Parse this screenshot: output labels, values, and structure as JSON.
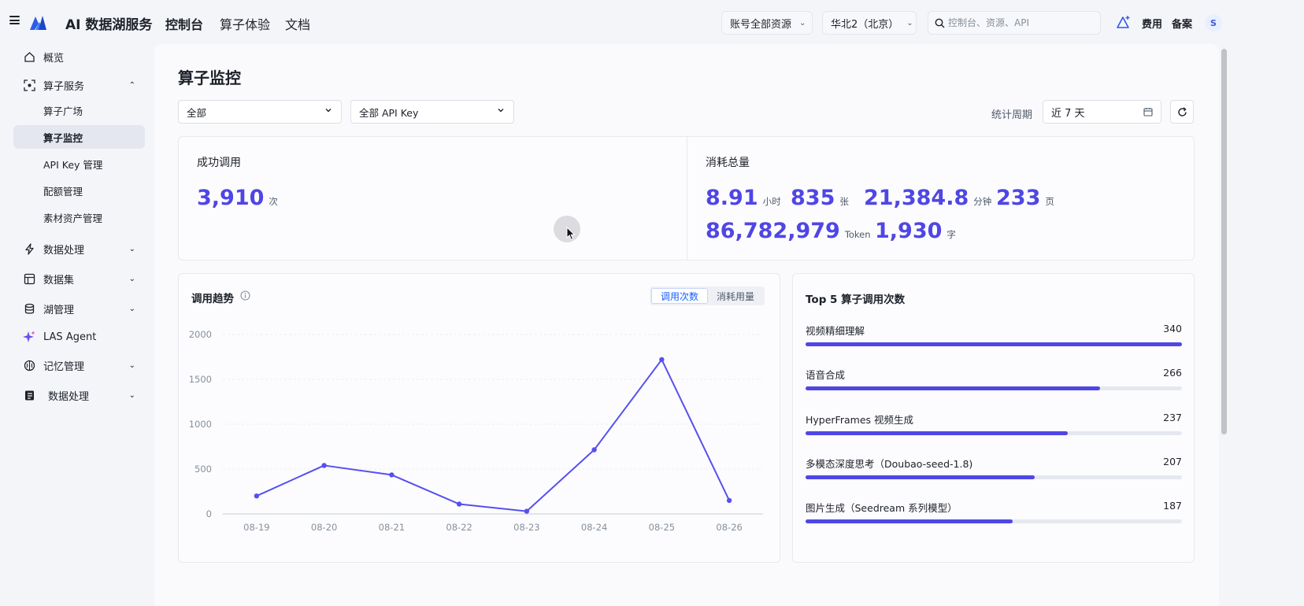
{
  "header": {
    "brand": "AI 数据湖服务",
    "nav": [
      "控制台",
      "算子体验",
      "文档"
    ],
    "account_scope": "账号全部资源",
    "region": "华北2（北京）",
    "search_placeholder": "控制台、资源、API",
    "links": [
      "费用",
      "备案"
    ],
    "avatar_initial": "S"
  },
  "sidebar": {
    "items": [
      {
        "label": "概览",
        "icon": "home-icon"
      },
      {
        "label": "算子服务",
        "icon": "operator-icon",
        "expanded": true,
        "children": [
          "算子广场",
          "算子监控",
          "API Key 管理",
          "配额管理",
          "素材资产管理"
        ]
      },
      {
        "label": "数据处理",
        "icon": "lightning-icon"
      },
      {
        "label": "数据集",
        "icon": "table-icon"
      },
      {
        "label": "湖管理",
        "icon": "database-icon"
      },
      {
        "label": "LAS Agent",
        "icon": "sparkle-icon"
      },
      {
        "label": "记忆管理",
        "icon": "brain-icon"
      },
      {
        "label": "数据处理",
        "icon": "notebook-icon"
      }
    ],
    "active_child": "算子监控"
  },
  "page": {
    "title": "算子监控",
    "filter_operator": "全部",
    "filter_apikey": "全部 API Key",
    "period_label": "统计周期",
    "period_value": "近 7 天"
  },
  "stats": {
    "success_title": "成功调用",
    "success_value": "3,910",
    "success_unit": "次",
    "consumption_title": "消耗总量",
    "consumption": [
      {
        "value": "8.91",
        "unit": "小时"
      },
      {
        "value": "835",
        "unit": "张"
      },
      {
        "value": "21,384.8",
        "unit": "分钟"
      },
      {
        "value": "233",
        "unit": "页"
      },
      {
        "value": "86,782,979",
        "unit": "Token"
      },
      {
        "value": "1,930",
        "unit": "字"
      }
    ]
  },
  "trend": {
    "title": "调用趋势",
    "tabs": [
      "调用次数",
      "消耗用量"
    ],
    "active_tab": "调用次数"
  },
  "chart_data": {
    "type": "line",
    "categories": [
      "08-19",
      "08-20",
      "08-21",
      "08-22",
      "08-23",
      "08-24",
      "08-25",
      "08-26"
    ],
    "values": [
      200,
      540,
      435,
      110,
      30,
      715,
      1720,
      150
    ],
    "ylim": [
      0,
      2000
    ],
    "yticks": [
      "2000",
      "1500",
      "1000",
      "500",
      "0"
    ],
    "color": "#5650f0",
    "grid": true
  },
  "top5": {
    "title": "Top 5 算子调用次数",
    "max": 340,
    "items": [
      {
        "label": "视频精细理解",
        "value": 340
      },
      {
        "label": "语音合成",
        "value": 266
      },
      {
        "label": "HyperFrames 视频生成",
        "value": 237
      },
      {
        "label": "多模态深度思考（Doubao-seed-1.8)",
        "value": 207
      },
      {
        "label": "图片生成（Seedream 系列模型）",
        "value": 187
      }
    ]
  }
}
